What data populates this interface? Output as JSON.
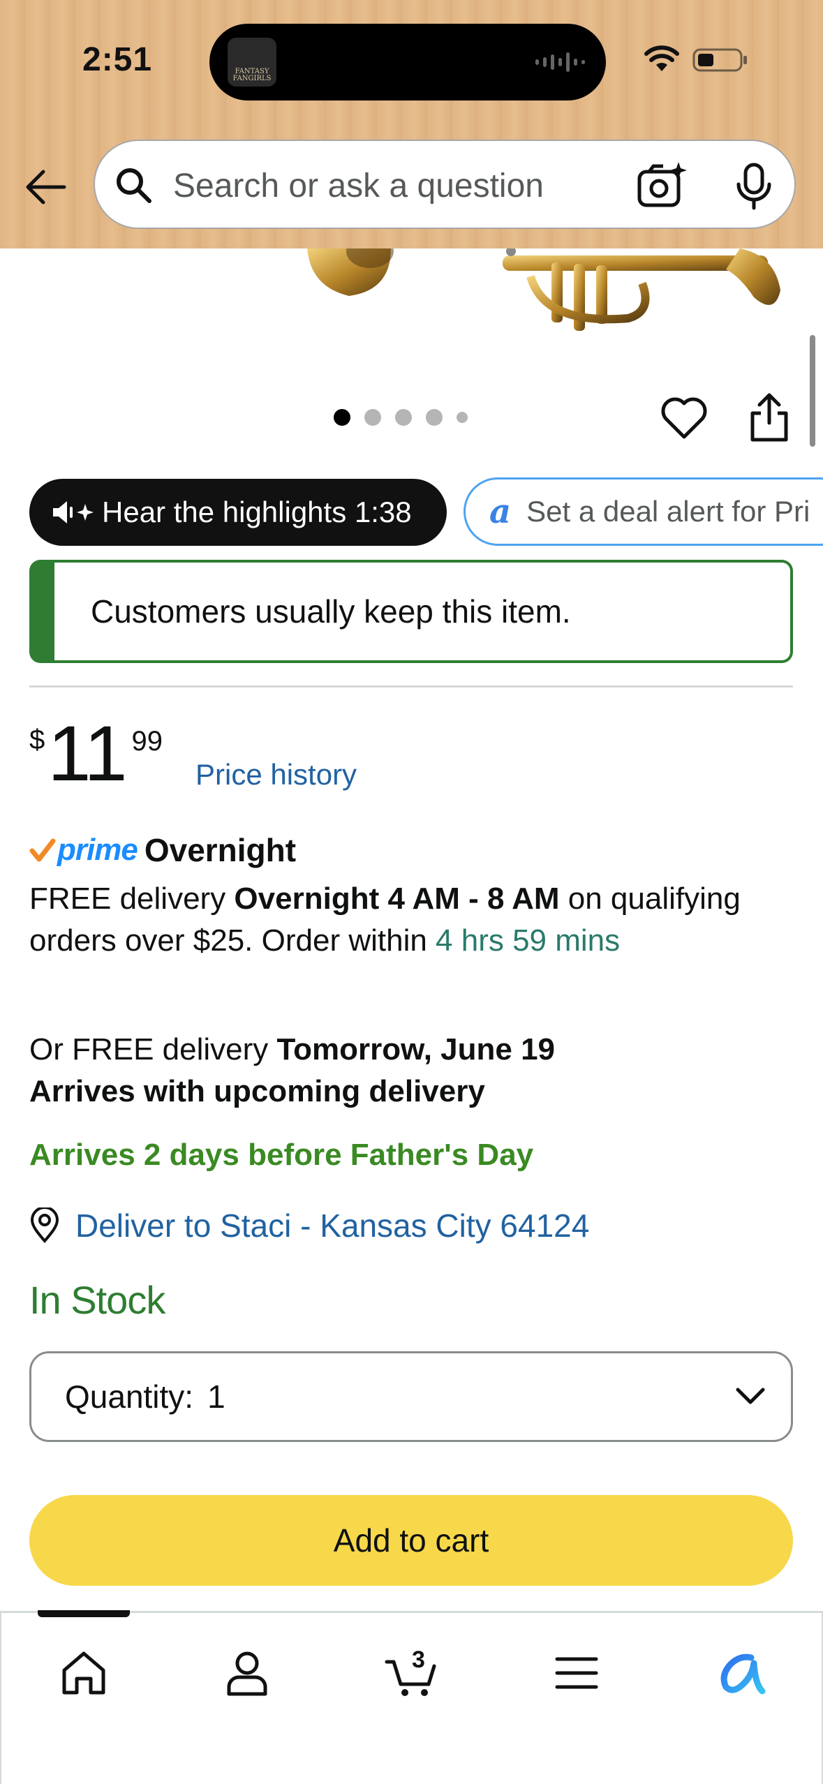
{
  "status_bar": {
    "time": "2:51",
    "island_app_logo_text": "FANTASY FANGIRLS"
  },
  "header": {
    "search_placeholder": "Search or ask a question",
    "background_color": "#e1b584"
  },
  "gallery": {
    "image_count": 5,
    "active_index": 0
  },
  "chips": {
    "highlights_label": "Hear the highlights 1:38",
    "deal_alert_label": "Set a deal alert for Pri"
  },
  "keep_banner": {
    "text": "Customers usually keep this item."
  },
  "price": {
    "symbol": "$",
    "whole": "11",
    "fraction": "99",
    "history_link": "Price history"
  },
  "delivery": {
    "prime_word": "prime",
    "prime_speed": "Overnight",
    "free_prefix": "FREE delivery ",
    "window": "Overnight 4 AM - 8 AM",
    "free_suffix": " on qualifying orders over $25. Order within ",
    "countdown": "4 hrs 59 mins",
    "alt_prefix": "Or FREE delivery ",
    "alt_date": "Tomorrow, June 19",
    "alt_note": "Arrives with upcoming delivery",
    "occasion": "Arrives 2 days before Father's Day",
    "deliver_to": "Deliver to Staci - Kansas City 64124",
    "stock": "In Stock"
  },
  "purchase": {
    "quantity_label": "Quantity:",
    "quantity_value": "1",
    "add_to_cart": "Add to cart"
  },
  "bottom_nav": {
    "items": [
      {
        "icon": "home-icon"
      },
      {
        "icon": "account-icon"
      },
      {
        "icon": "cart-icon",
        "badge": "3"
      },
      {
        "icon": "menu-icon"
      },
      {
        "icon": "rufus-icon"
      }
    ]
  },
  "colors": {
    "accent_link": "#2162a1",
    "in_stock_green": "#2e7d32",
    "add_to_cart_yellow": "#f6d84a",
    "prime_blue": "#1a8cff"
  }
}
